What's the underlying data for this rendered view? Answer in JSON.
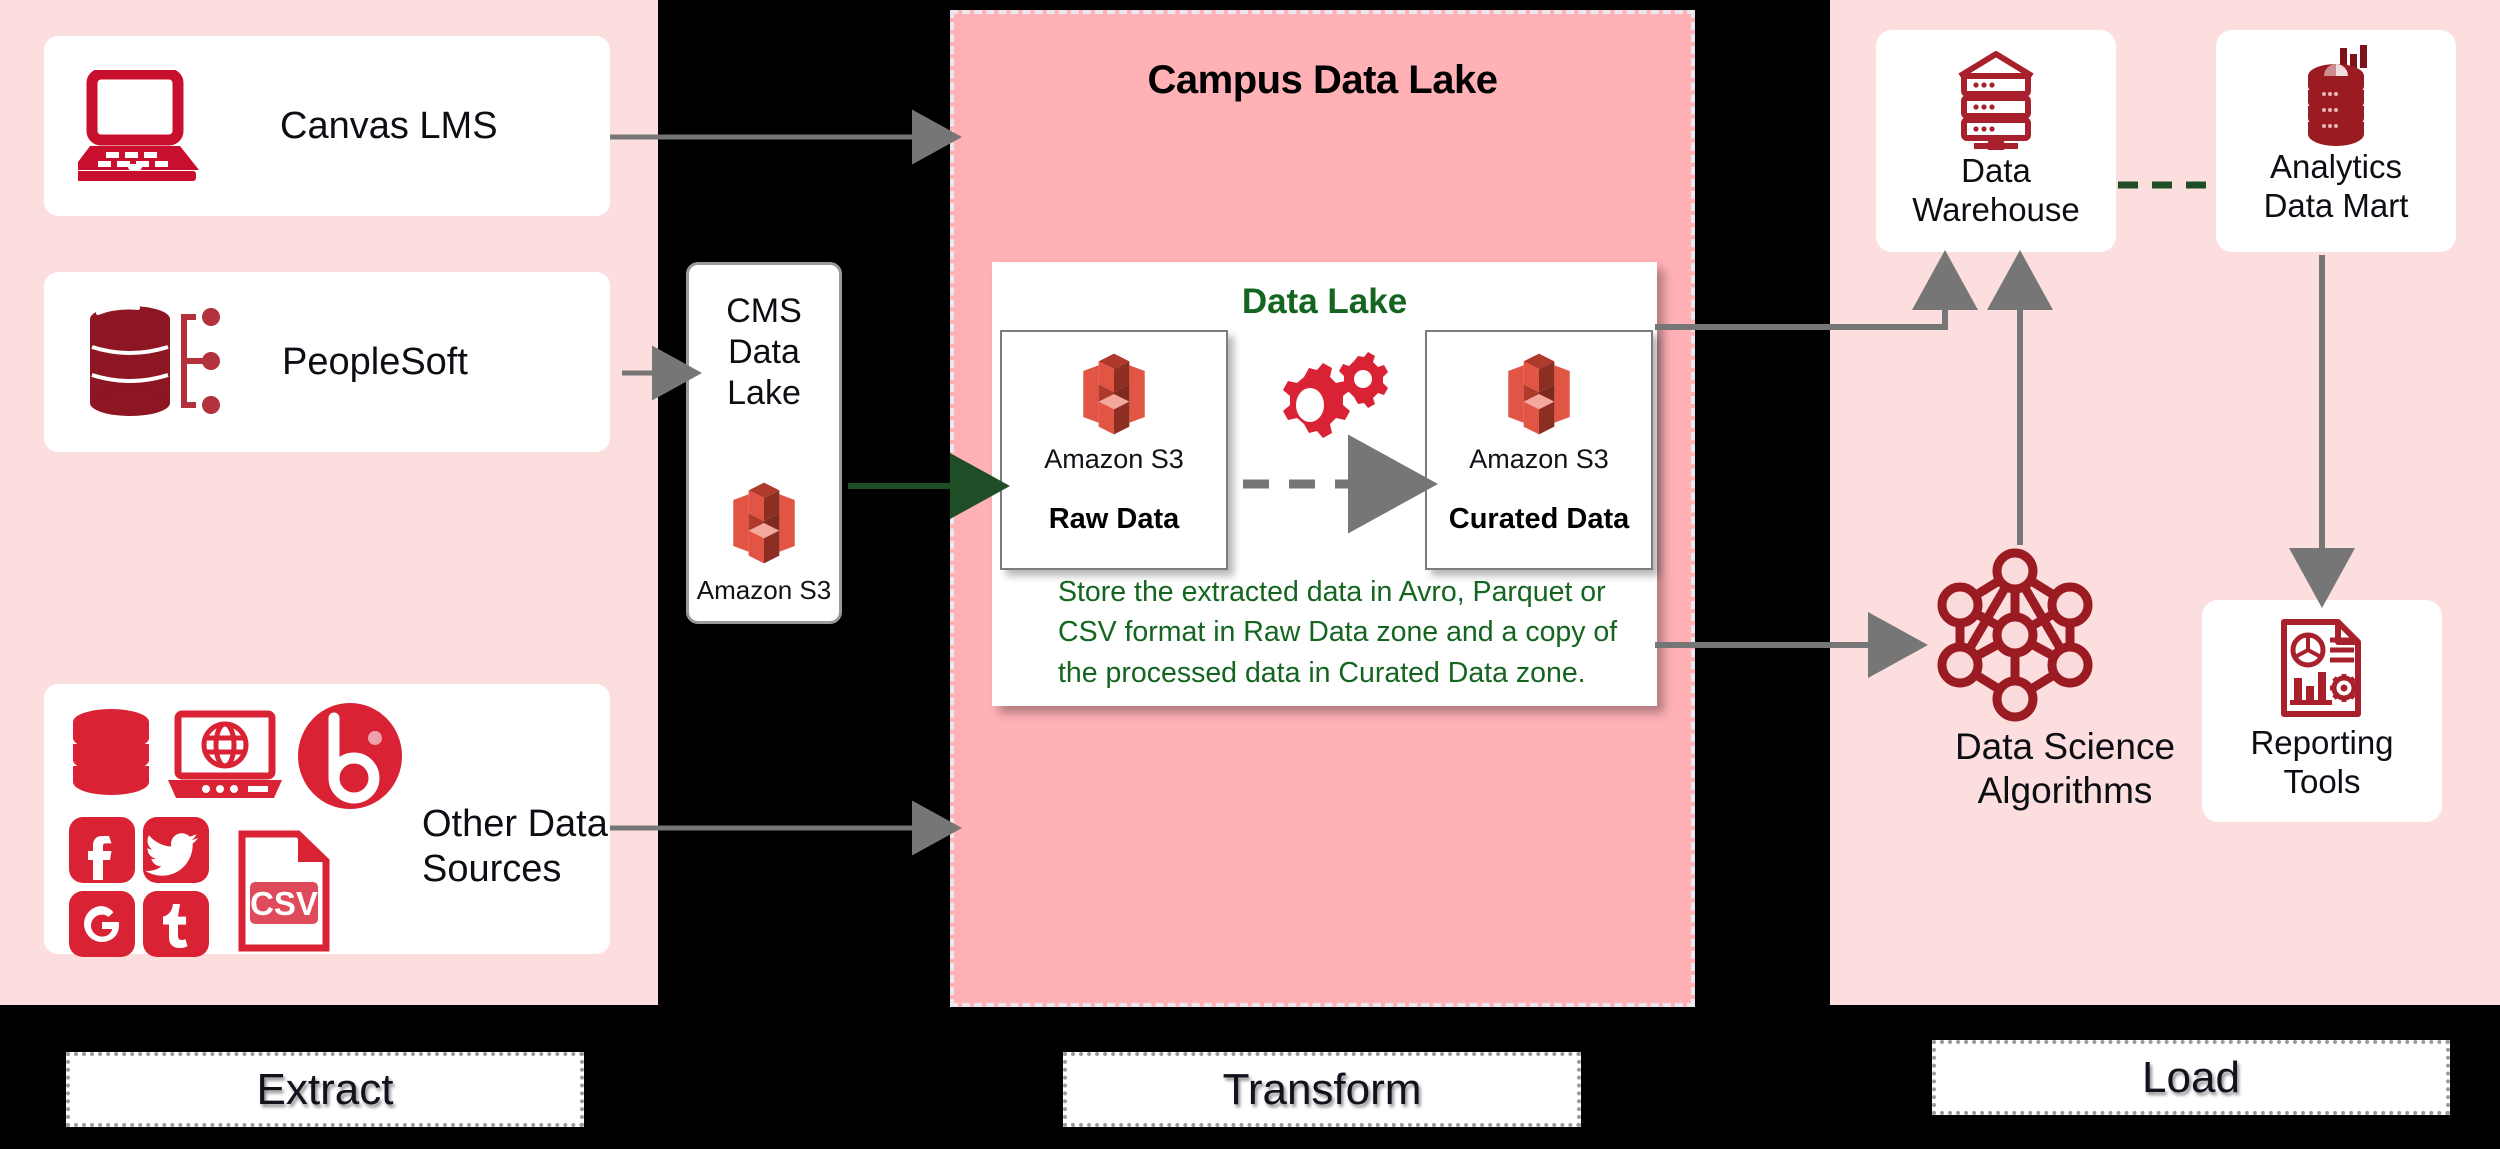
{
  "theme": {
    "background": "#000000",
    "panel_extract_bg": "#FDDEDE",
    "panel_transform_bg": "#FFB1B6",
    "panel_load_bg": "#FDDEDE",
    "brand_red": "#C8102E",
    "dark_red": "#9B1B22",
    "aws_orange": "#E25444",
    "green_text": "#14651F",
    "arrow_grey": "#767676"
  },
  "stages": {
    "extract": "Extract",
    "transform": "Transform",
    "load": "Load"
  },
  "extract": {
    "sources": [
      {
        "label": "Canvas LMS",
        "icon": "laptop-icon"
      },
      {
        "label": "PeopleSoft",
        "icon": "database-branch-icon"
      },
      {
        "label": "Other Data\nSources",
        "label_line1": "Other Data",
        "label_line2": "Sources",
        "icons": [
          "database-stack-icon",
          "web-laptop-icon",
          "blackboard-b-icon",
          "facebook-icon",
          "twitter-icon",
          "google-plus-icon",
          "tumblr-icon",
          "csv-file-icon"
        ]
      }
    ],
    "cms": {
      "title_line1": "CMS Data",
      "title_line2": "Lake",
      "service": "Amazon S3",
      "icon": "amazon-s3-icon"
    }
  },
  "transform": {
    "title": "Campus Data Lake",
    "datalake": {
      "title": "Data Lake",
      "zones": [
        {
          "service": "Amazon S3",
          "name": "Raw Data",
          "icon": "amazon-s3-icon"
        },
        {
          "service": "Amazon S3",
          "name": "Curated Data",
          "icon": "amazon-s3-icon"
        }
      ],
      "process_icon": "gears-icon",
      "caption": "Store the extracted data in Avro, Parquet or CSV format in Raw Data zone and a copy of the processed data in Curated Data zone."
    }
  },
  "load": {
    "targets": [
      {
        "label_line1": "Data",
        "label_line2": "Warehouse",
        "icon": "data-warehouse-icon"
      },
      {
        "label_line1": "Analytics",
        "label_line2": "Data Mart",
        "icon": "analytics-data-mart-icon"
      },
      {
        "label_line1": "Reporting",
        "label_line2": "Tools",
        "icon": "reporting-tools-icon"
      }
    ],
    "data_science": {
      "label_line1": "Data Science",
      "label_line2": "Algorithms",
      "icon": "neural-network-icon"
    }
  }
}
